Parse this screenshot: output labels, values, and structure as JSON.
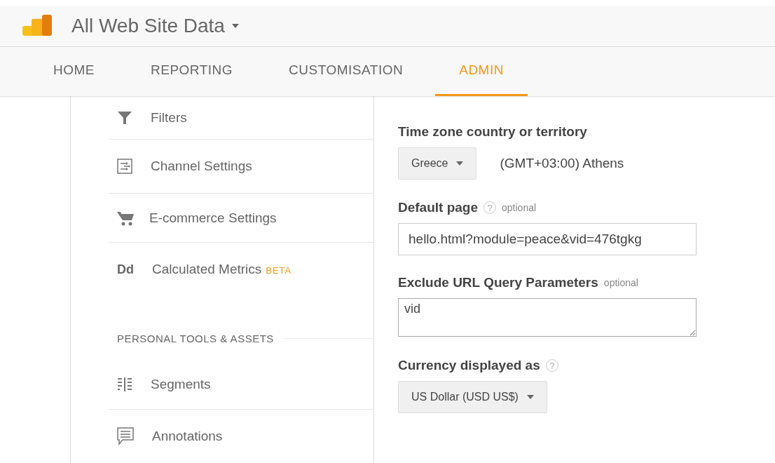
{
  "header": {
    "title": "All Web Site Data"
  },
  "tabs": [
    {
      "label": "HOME",
      "selected": false
    },
    {
      "label": "REPORTING",
      "selected": false
    },
    {
      "label": "CUSTOMISATION",
      "selected": false
    },
    {
      "label": "ADMIN",
      "selected": true
    }
  ],
  "sidebar": {
    "items": [
      {
        "kind": "filter",
        "label": "Filters"
      },
      {
        "kind": "channel",
        "label": "Channel Settings"
      },
      {
        "kind": "cart",
        "label": "E-commerce Settings"
      },
      {
        "kind": "metrics",
        "label": "Calculated Metrics",
        "icon_text": "Dd",
        "badge": "BETA"
      }
    ],
    "section": {
      "heading": "PERSONAL TOOLS & ASSETS",
      "items": [
        {
          "kind": "segments",
          "label": "Segments"
        },
        {
          "kind": "annotations",
          "label": "Annotations"
        }
      ]
    }
  },
  "form": [
    {
      "kind": "select",
      "label": "Time zone country or territory",
      "value": "Greece",
      "note": "(GMT+03:00) Athens"
    },
    {
      "kind": "input",
      "label": "Default page",
      "help": "?",
      "optional": "optional",
      "value": "hello.html?module=peace&vid=476tgkg"
    },
    {
      "kind": "textarea",
      "label": "Exclude URL Query Parameters",
      "optional": "optional",
      "value": "vid"
    },
    {
      "kind": "select",
      "label": "Currency displayed as",
      "help": "?",
      "value": "US Dollar (USD US$)"
    }
  ]
}
